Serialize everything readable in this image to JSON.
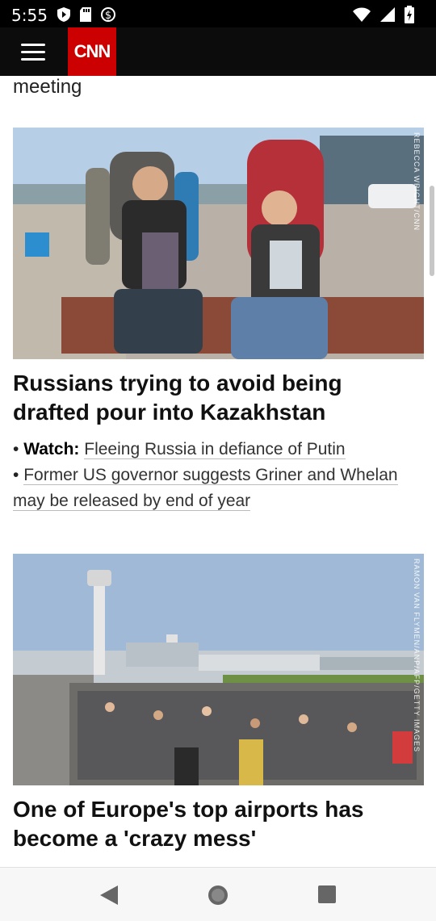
{
  "status_bar": {
    "time": "5:55"
  },
  "header": {
    "logo_text": "CNN"
  },
  "partial_previous_title": "meeting",
  "stories": [
    {
      "photo_credit": "REBECCA WRIGHT/CNN",
      "headline": "Russians trying to avoid being drafted pour into Kazakhstan",
      "bullets": [
        {
          "prefix": "Watch:",
          "text": "Fleeing Russia in defiance of Putin"
        },
        {
          "prefix": "",
          "text": "Former US governor suggests Griner and Whelan may be released by end of year"
        }
      ]
    },
    {
      "photo_credit": "RAMON VAN FLYMEN/ANP/AFP/GETTY IMAGES",
      "headline": "One of Europe's top airports has become a 'crazy mess'"
    }
  ]
}
